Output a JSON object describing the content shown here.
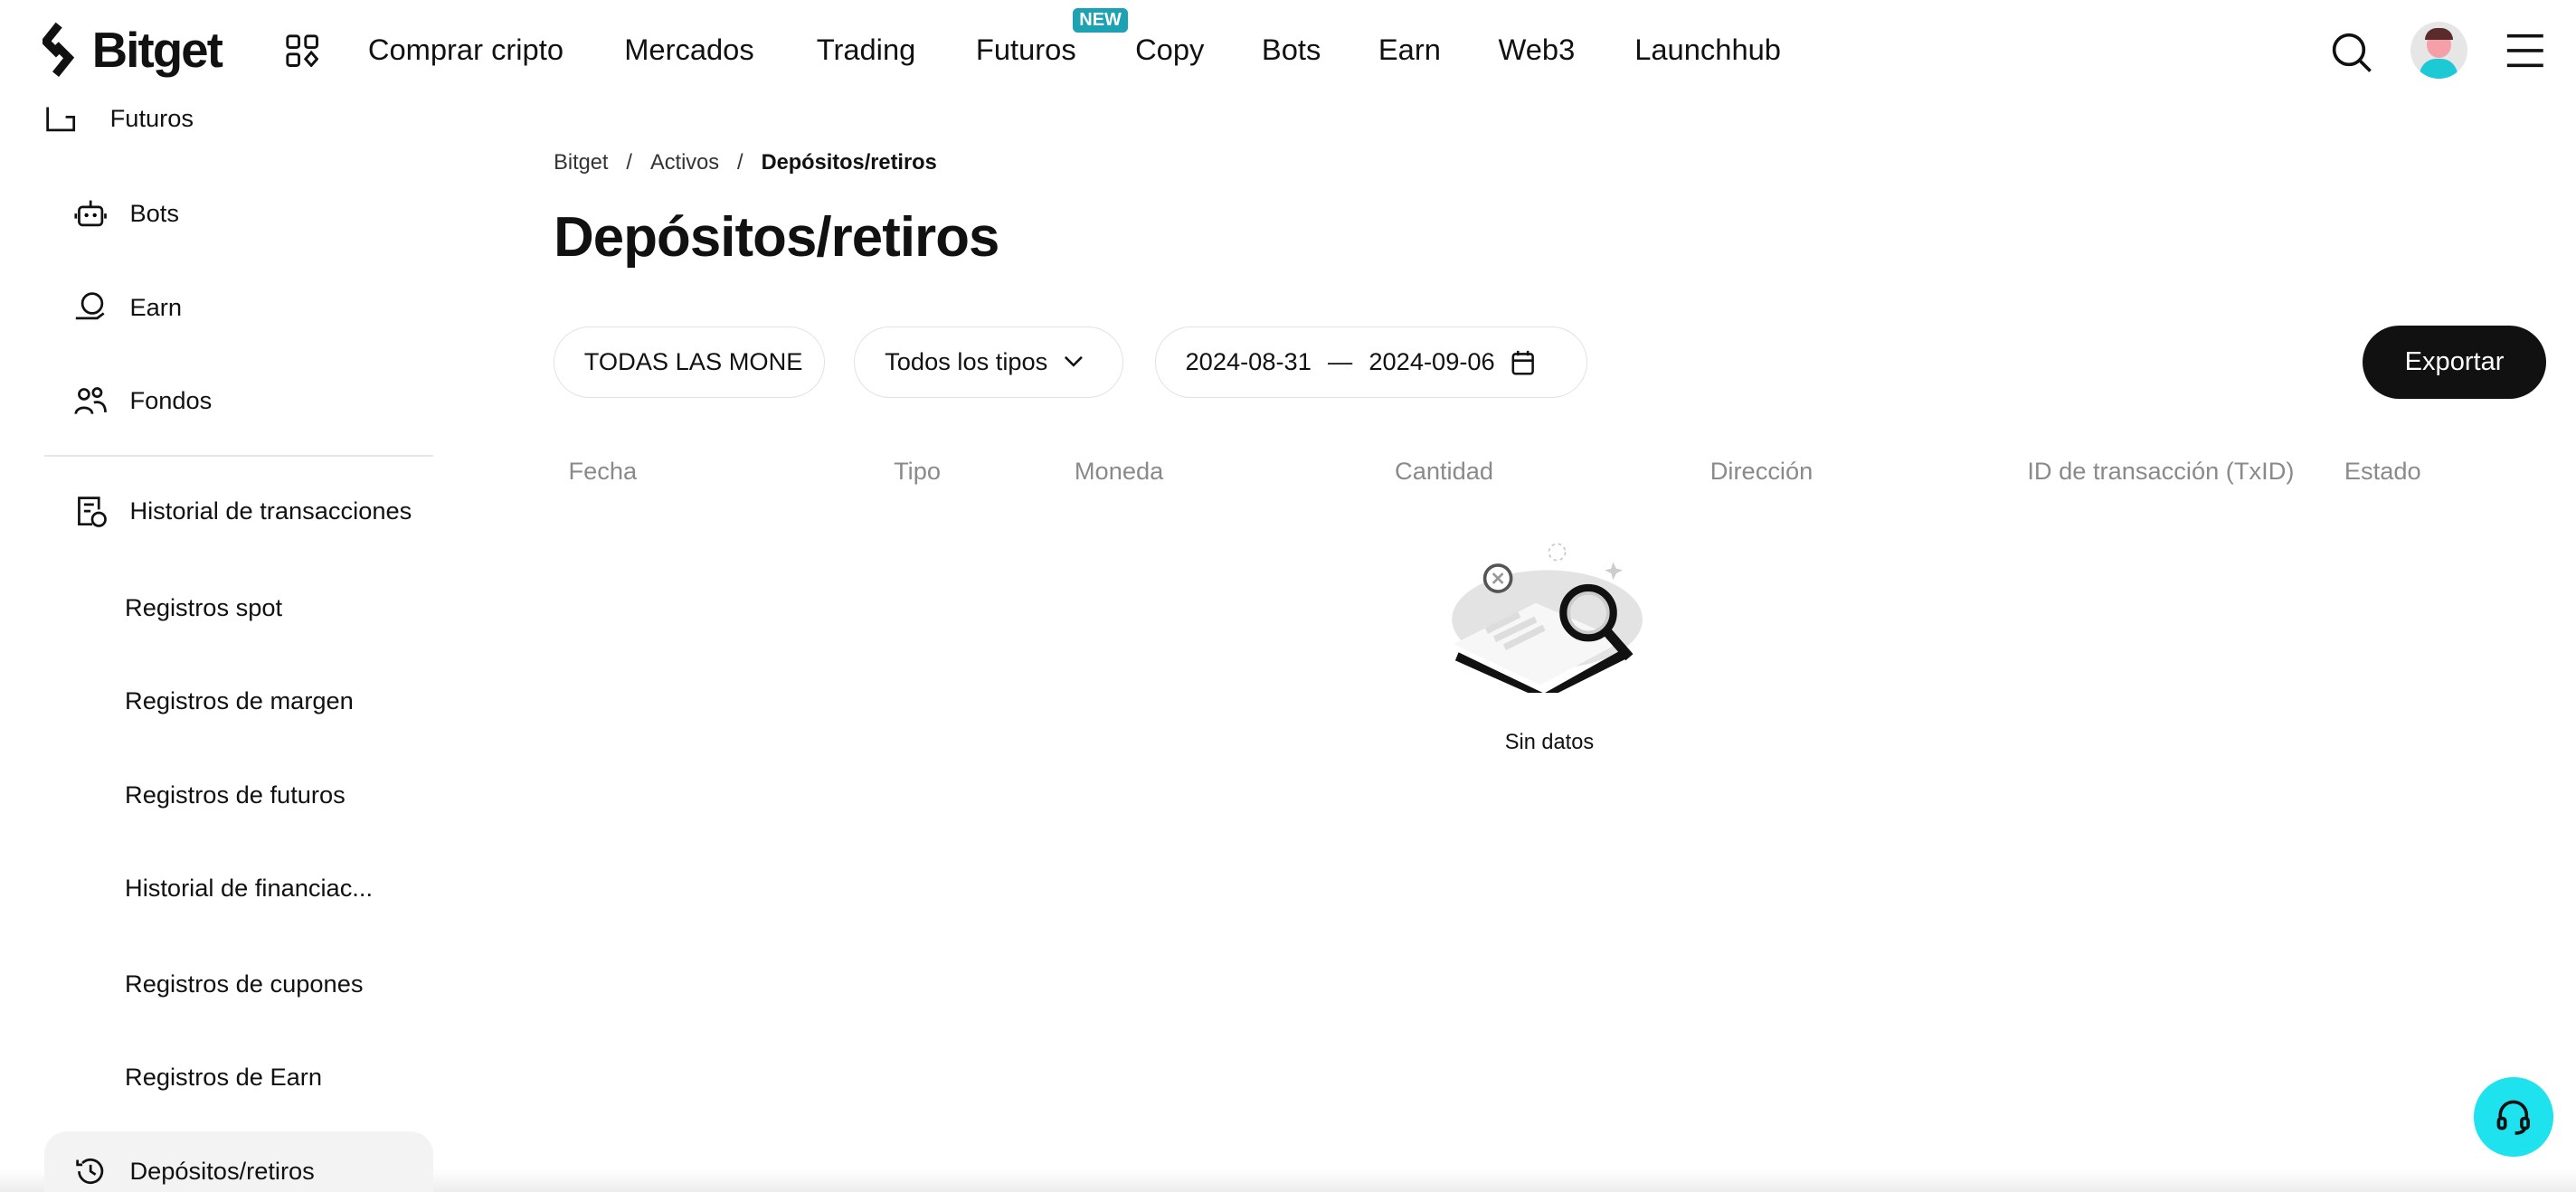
{
  "brand": "Bitget",
  "nav": {
    "items": [
      "Comprar cripto",
      "Mercados",
      "Trading",
      "Futuros",
      "Copy",
      "Bots",
      "Earn",
      "Web3",
      "Launchhub"
    ],
    "new_badge": "NEW"
  },
  "sidebar": {
    "items": [
      "Futuros",
      "Bots",
      "Earn",
      "Fondos"
    ],
    "section": "Historial de transacciones",
    "subitems": [
      "Registros spot",
      "Registros de margen",
      "Registros de futuros",
      "Historial de financiac...",
      "Registros de cupones",
      "Registros de Earn"
    ],
    "active": "Depósitos/retiros"
  },
  "breadcrumb": [
    "Bitget",
    "Activos",
    "Depósitos/retiros"
  ],
  "title": "Depósitos/retiros",
  "filters": {
    "coin": "TODAS LAS MONE",
    "type": "Todos los tipos",
    "date_start": "2024-08-31",
    "date_sep": "—",
    "date_end": "2024-09-06"
  },
  "export_label": "Exportar",
  "table": {
    "columns": [
      "Fecha",
      "Tipo",
      "Moneda",
      "Cantidad",
      "Dirección",
      "ID de transacción (TxID)",
      "Estado"
    ]
  },
  "empty_text": "Sin datos",
  "colors": {
    "accent": "#1da2b4",
    "support": "#1ee3ef",
    "export_bg": "#111111"
  }
}
